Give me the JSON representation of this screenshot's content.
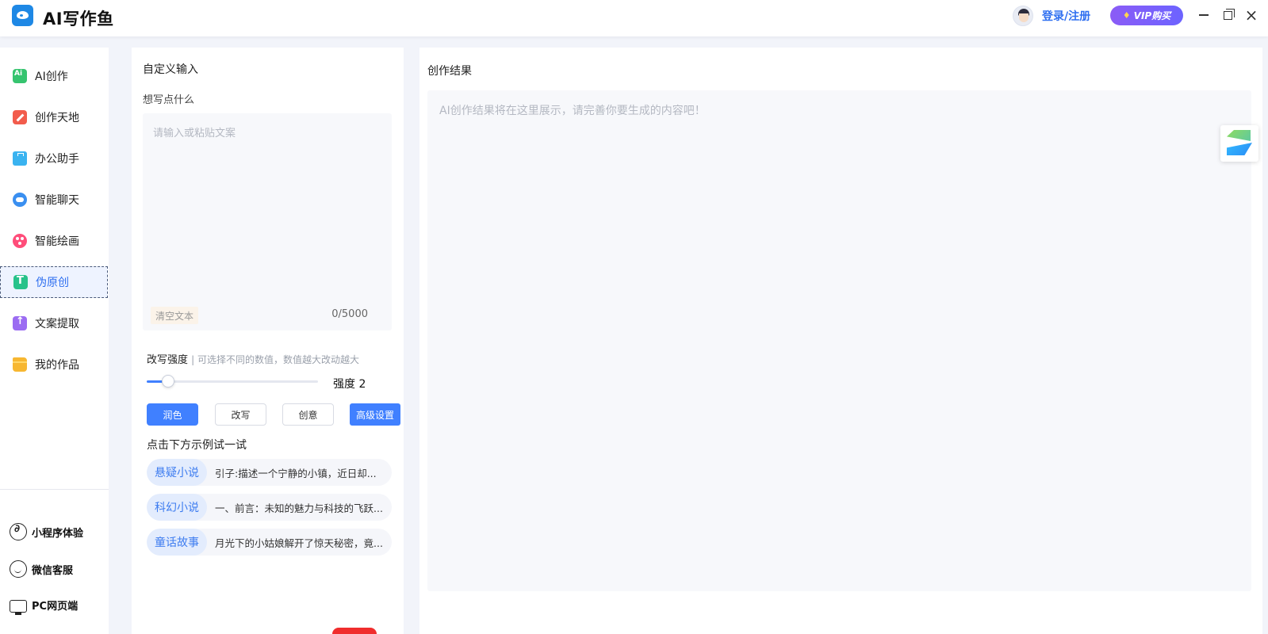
{
  "header": {
    "app_title": "AI写作鱼",
    "login_label": "登录/注册",
    "vip_label": "VIP购买",
    "close_glyph": "×"
  },
  "sidebar": {
    "items": [
      {
        "label": "AI创作",
        "icon": "ai-icon"
      },
      {
        "label": "创作天地",
        "icon": "pen-icon"
      },
      {
        "label": "办公助手",
        "icon": "briefcase-icon"
      },
      {
        "label": "智能聊天",
        "icon": "chat-icon"
      },
      {
        "label": "智能绘画",
        "icon": "palette-icon"
      },
      {
        "label": "伪原创",
        "icon": "text-icon",
        "active": true
      },
      {
        "label": "文案提取",
        "icon": "upload-icon"
      },
      {
        "label": "我的作品",
        "icon": "folder-icon"
      }
    ],
    "bottom": [
      {
        "label": "小程序体验",
        "icon": "mini-program-icon"
      },
      {
        "label": "微信客服",
        "icon": "wechat-icon"
      },
      {
        "label": "PC网页端",
        "icon": "pc-icon"
      }
    ]
  },
  "input_panel": {
    "title": "自定义输入",
    "prompt_label": "想写点什么",
    "placeholder": "请输入或粘贴文案",
    "value": "",
    "clear_label": "清空文本",
    "char_count": "0/5000",
    "strength_label": "改写强度",
    "strength_hint": "| 可选择不同的数值，数值越大改动越大",
    "strength_value": 2,
    "strength_max": 9,
    "strength_text": "强度 2",
    "modes": [
      {
        "label": "润色",
        "active": true
      },
      {
        "label": "改写",
        "active": false
      },
      {
        "label": "创意",
        "active": false
      }
    ],
    "advanced_label": "高级设置",
    "examples_title": "点击下方示例试一试",
    "examples": [
      {
        "tag": "悬疑小说",
        "text": "引子:描述一个宁静的小镇，近日却..."
      },
      {
        "tag": "科幻小说",
        "text": "一、前言：未知的魅力与科技的飞跃..."
      },
      {
        "tag": "童话故事",
        "text": "月光下的小姑娘解开了惊天秘密，竟..."
      }
    ]
  },
  "result_panel": {
    "title": "创作结果",
    "placeholder": "AI创作结果将在这里展示，请完善你要生成的内容吧！"
  },
  "colors": {
    "accent": "#4080ff",
    "link": "#2f6ff0",
    "vip_gradient_start": "#8b5cf6",
    "vip_gradient_end": "#6c63ff"
  }
}
